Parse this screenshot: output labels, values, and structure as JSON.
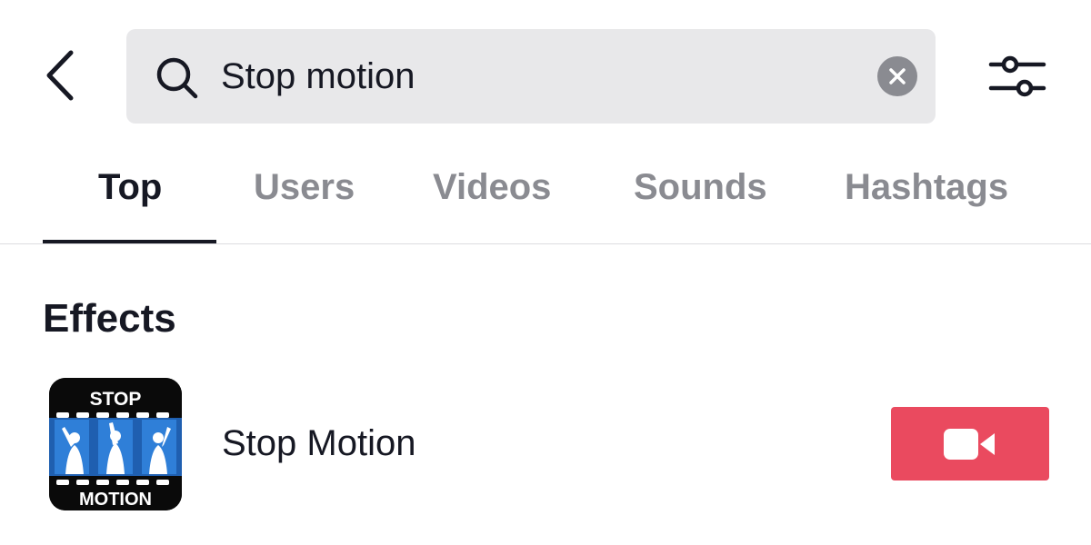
{
  "header": {
    "back_icon": "chevron-left-icon",
    "search": {
      "value": "Stop motion",
      "icon": "search-icon",
      "clear_icon": "clear-x-icon"
    },
    "filter_icon": "sliders-icon"
  },
  "tabs": [
    {
      "label": "Top",
      "active": true
    },
    {
      "label": "Users",
      "active": false
    },
    {
      "label": "Videos",
      "active": false
    },
    {
      "label": "Sounds",
      "active": false
    },
    {
      "label": "Hashtags",
      "active": false
    }
  ],
  "effects_section": {
    "title": "Effects",
    "items": [
      {
        "name": "Stop Motion",
        "thumbnail_text_top": "STOP",
        "thumbnail_text_bottom": "MOTION",
        "action_icon": "video-camera-icon"
      }
    ]
  },
  "colors": {
    "accent": "#ea4a5f",
    "text_primary": "#161823",
    "text_secondary": "#8a8b91",
    "search_bg": "#e8e8ea"
  }
}
